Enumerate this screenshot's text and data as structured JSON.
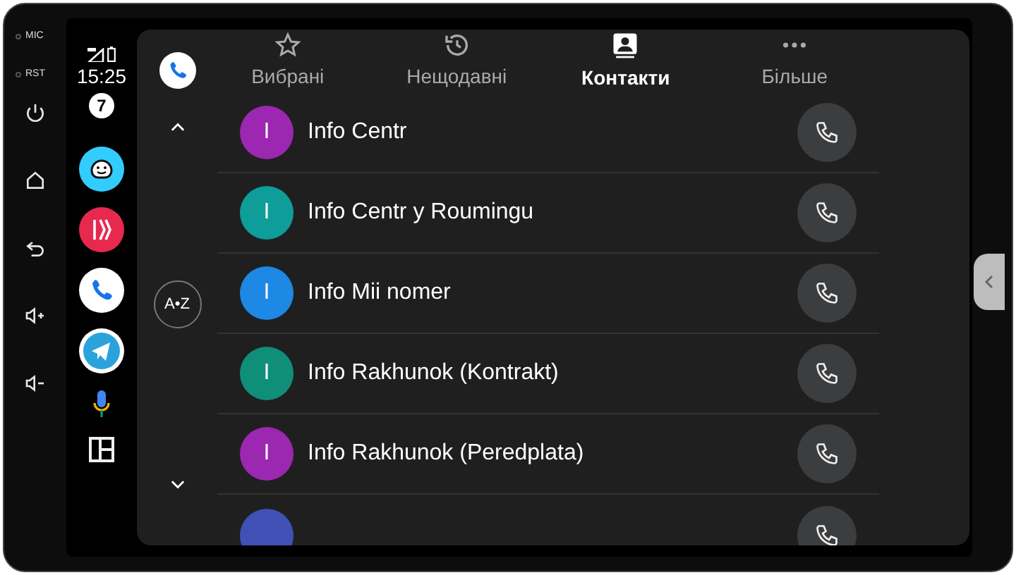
{
  "hardware_buttons": [
    {
      "kind": "led",
      "label": "MIC"
    },
    {
      "kind": "led",
      "label": "RST"
    },
    {
      "kind": "power"
    },
    {
      "kind": "home"
    },
    {
      "kind": "back"
    },
    {
      "kind": "vol_up"
    },
    {
      "kind": "vol_down"
    }
  ],
  "status": {
    "time": "15:25",
    "notification_count": "7"
  },
  "dock": [
    {
      "kind": "waze"
    },
    {
      "kind": "lines"
    },
    {
      "kind": "phone"
    },
    {
      "kind": "telegram"
    },
    {
      "kind": "mic"
    },
    {
      "kind": "layout"
    }
  ],
  "tabs": [
    {
      "kind": "star",
      "label": "Вибрані",
      "selected": false
    },
    {
      "kind": "history",
      "label": "Нещодавні",
      "selected": false
    },
    {
      "kind": "contacts",
      "label": "Контакти",
      "selected": true
    },
    {
      "kind": "more",
      "label": "Більше",
      "selected": false
    }
  ],
  "alphabet_button": "A•Z",
  "contacts": [
    {
      "initial": "I",
      "name": "Info Centr",
      "color": "#9c27b0"
    },
    {
      "initial": "I",
      "name": "Info Centr y Roumingu",
      "color": "#0f9d9a"
    },
    {
      "initial": "I",
      "name": "Info Mii nomer",
      "color": "#1e88e5"
    },
    {
      "initial": "I",
      "name": "Info Rakhunok (Kontrakt)",
      "color": "#0f8f78"
    },
    {
      "initial": "I",
      "name": "Info Rakhunok (Peredplata)",
      "color": "#9c27b0"
    },
    {
      "color": "#3f51b5"
    }
  ]
}
